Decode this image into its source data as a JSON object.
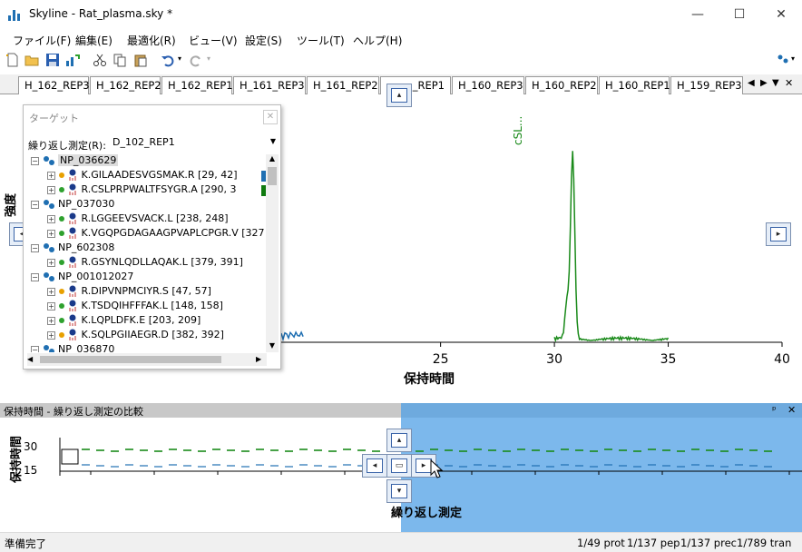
{
  "window": {
    "title": "Skyline - Rat_plasma.sky *",
    "minimize": "—",
    "maximize": "☐",
    "close": "✕"
  },
  "menu": [
    "ファイル(F)",
    "編集(E)",
    "最適化(R)",
    "ビュー(V)",
    "設定(S)",
    "ツール(T)",
    "ヘルプ(H)"
  ],
  "tabs": [
    "H_162_REP3",
    "H_162_REP2",
    "H_162_REP1",
    "H_161_REP3",
    "H_161_REP2",
    "_REP1",
    "H_160_REP3",
    "H_160_REP2",
    "H_160_REP1",
    "H_159_REP3"
  ],
  "tabnav": {
    "left": "◀",
    "right": "▶",
    "menu": "▼",
    "close": "✕"
  },
  "chromatogram": {
    "peak_label": "cSL...",
    "x_label": "保持時間",
    "y_label": "強度",
    "x_ticks": [
      "25",
      "30",
      "35",
      "40"
    ],
    "x_tick_values": [
      25,
      30,
      35,
      40
    ],
    "xlim": [
      18,
      40
    ],
    "peak_rt": 30.8
  },
  "target": {
    "title": "ターゲット",
    "rep_label": "繰り返し測定(R):",
    "rep_value": "D_102_REP1",
    "nodes": [
      {
        "kind": "protein",
        "text": "NP_036629",
        "selected": true
      },
      {
        "kind": "peptide",
        "text": "K.GILAADESVGSMAK.R [29, 42]",
        "dot": "#e8a000",
        "swatch": "#1f6fb2"
      },
      {
        "kind": "peptide",
        "text": "R.CSLPRPWALTFSYGR.A [290, 3",
        "dot": "#2ea12e",
        "swatch": "#0f7a0f"
      },
      {
        "kind": "protein",
        "text": "NP_037030"
      },
      {
        "kind": "peptide",
        "text": "R.LGGEEVSVACK.L [238, 248]",
        "dot": "#2ea12e"
      },
      {
        "kind": "peptide",
        "text": "K.VGQPGDAGAAGPVAPLCPGR.V [327",
        "dot": "#2ea12e"
      },
      {
        "kind": "protein",
        "text": "NP_602308"
      },
      {
        "kind": "peptide",
        "text": "R.GSYNLQDLLAQAK.L [379, 391]",
        "dot": "#2ea12e"
      },
      {
        "kind": "protein",
        "text": "NP_001012027"
      },
      {
        "kind": "peptide",
        "text": "R.DIPVNPMCIYR.S [47, 57]",
        "dot": "#e8a000"
      },
      {
        "kind": "peptide",
        "text": "K.TSDQIHFFFAK.L [148, 158]",
        "dot": "#2ea12e"
      },
      {
        "kind": "peptide",
        "text": "K.LQPLDFK.E [203, 209]",
        "dot": "#2ea12e"
      },
      {
        "kind": "peptide",
        "text": "K.SQLPGIIAEGR.D [382, 392]",
        "dot": "#e8a000"
      },
      {
        "kind": "protein",
        "text": "NP_036870"
      }
    ]
  },
  "bottom": {
    "title": "保持時間 - 繰り返し測定の比較",
    "pin": "ᵖ",
    "close": "✕",
    "y_label": "保持時間",
    "y_ticks": [
      "30",
      "15"
    ],
    "x_label": "繰り返し測定"
  },
  "status": {
    "left": "準備完了",
    "prot": "1/49 prot",
    "pep": "1/137 pep",
    "prec": "1/137 prec",
    "tran": "1/789 tran"
  },
  "colors": {
    "green": "#1a8a1a",
    "blue": "#1f6fb2",
    "highlight": "#5aa0e6"
  }
}
